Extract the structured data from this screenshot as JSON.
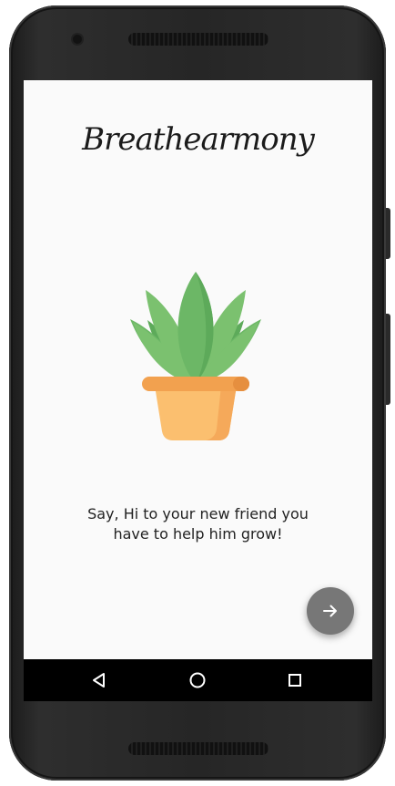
{
  "app": {
    "logo_text": "Breathearmony"
  },
  "onboarding": {
    "illustration_icon": "potted-plant-icon",
    "message_line1": "Say, Hi to your new friend you",
    "message_line2": "have to help him grow!",
    "next_icon": "arrow-right-icon"
  },
  "navigation_bar": {
    "back_icon": "back-triangle-icon",
    "home_icon": "home-circle-icon",
    "recents_icon": "recents-square-icon"
  },
  "colors": {
    "screen_background": "#fafafa",
    "text": "#222222",
    "fab_background": "#777777",
    "leaf_dark": "#5daa5a",
    "leaf_light": "#7bc16f",
    "pot": "#fbbf6f",
    "pot_rim": "#f2a14f"
  }
}
